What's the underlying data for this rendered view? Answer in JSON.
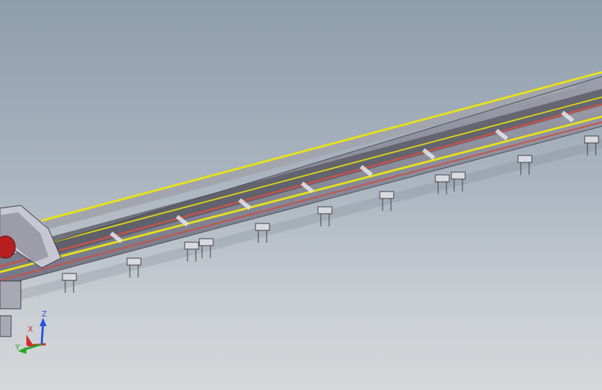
{
  "viewport": {
    "colors": {
      "rail_yellow": "#e8e21a",
      "rail_red": "#c7524a",
      "frame_grey": "#8b8c98",
      "frame_light": "#c7c7d2",
      "motor_red": "#b81e1e",
      "axis_x": "#d42a2a",
      "axis_y": "#25a825",
      "axis_z": "#2b52d8"
    }
  },
  "triad": {
    "x_label": "X",
    "y_label": "Y",
    "z_label": "Z"
  }
}
